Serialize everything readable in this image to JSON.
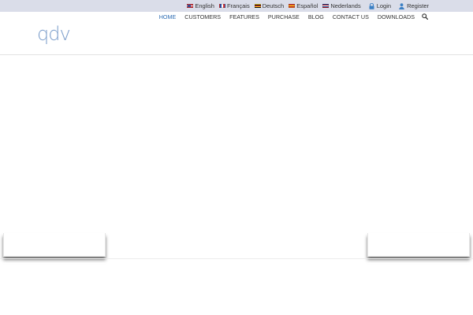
{
  "topbar": {
    "languages": [
      {
        "label": "English",
        "flag": "us"
      },
      {
        "label": "Français",
        "flag": "fr"
      },
      {
        "label": "Deutsch",
        "flag": "de"
      },
      {
        "label": "Español",
        "flag": "es"
      },
      {
        "label": "Nederlands",
        "flag": "nl"
      }
    ],
    "login_label": "Login",
    "register_label": "Register"
  },
  "header": {
    "logo_text": "qdv",
    "nav": [
      {
        "label": "HOME",
        "active": true
      },
      {
        "label": "CUSTOMERS",
        "active": false
      },
      {
        "label": "FEATURES",
        "active": false
      },
      {
        "label": "PURCHASE",
        "active": false
      },
      {
        "label": "BLOG",
        "active": false
      },
      {
        "label": "CONTACT US",
        "active": false
      },
      {
        "label": "DOWNLOADS",
        "active": false
      }
    ]
  },
  "colors": {
    "topbar_bg": "#dadde9",
    "accent": "#2f6db3",
    "logo": "#7c9ecb"
  },
  "icons": {
    "login": "lock-icon",
    "register": "user-icon",
    "search": "search-icon"
  }
}
